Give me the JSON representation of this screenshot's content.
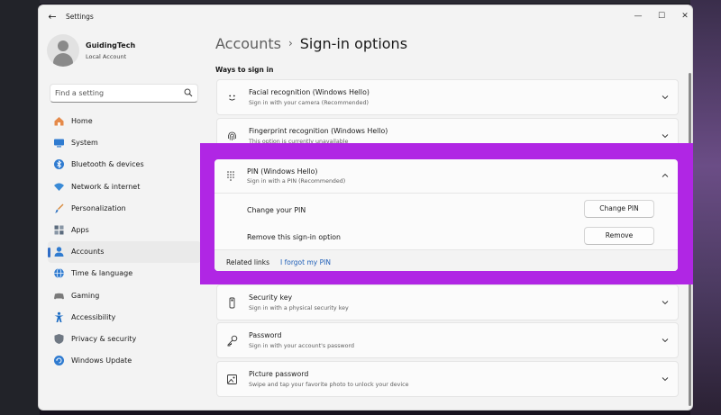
{
  "window": {
    "title": "Settings",
    "back_glyph": "←",
    "minimize_glyph": "—",
    "maximize_glyph": "☐",
    "close_glyph": "✕"
  },
  "profile": {
    "name": "GuidingTech",
    "account_type": "Local Account"
  },
  "search": {
    "placeholder": "Find a setting"
  },
  "sidebar": {
    "items": [
      {
        "label": "Home",
        "icon": "home-icon",
        "color": "#e07a3d"
      },
      {
        "label": "System",
        "icon": "system-icon",
        "color": "#2f7bd0"
      },
      {
        "label": "Bluetooth & devices",
        "icon": "bluetooth-icon",
        "color": "#2f7bd0"
      },
      {
        "label": "Network & internet",
        "icon": "network-icon",
        "color": "#3a8ad6"
      },
      {
        "label": "Personalization",
        "icon": "brush-icon",
        "color": "#d98a3c"
      },
      {
        "label": "Apps",
        "icon": "apps-icon",
        "color": "#5b6b7d"
      },
      {
        "label": "Accounts",
        "icon": "accounts-icon",
        "color": "#2f7bd0",
        "active": true
      },
      {
        "label": "Time & language",
        "icon": "globe-icon",
        "color": "#2f7bd0"
      },
      {
        "label": "Gaming",
        "icon": "gaming-icon",
        "color": "#7a7a7a"
      },
      {
        "label": "Accessibility",
        "icon": "accessibility-icon",
        "color": "#1f6ec4"
      },
      {
        "label": "Privacy & security",
        "icon": "shield-icon",
        "color": "#6f7883"
      },
      {
        "label": "Windows Update",
        "icon": "update-icon",
        "color": "#2f7bd0"
      }
    ]
  },
  "breadcrumb": {
    "parent": "Accounts",
    "separator": "›",
    "current": "Sign-in options"
  },
  "section": {
    "title": "Ways to sign in"
  },
  "sign_in_options": [
    {
      "title": "Facial recognition (Windows Hello)",
      "subtitle": "Sign in with your camera (Recommended)",
      "icon": "face-icon"
    },
    {
      "title": "Fingerprint recognition (Windows Hello)",
      "subtitle": "This option is currently unavailable",
      "icon": "fingerprint-icon"
    },
    {
      "title": "Security key",
      "subtitle": "Sign in with a physical security key",
      "icon": "security-key-icon"
    },
    {
      "title": "Password",
      "subtitle": "Sign in with your account's password",
      "icon": "key-icon"
    },
    {
      "title": "Picture password",
      "subtitle": "Swipe and tap your favorite photo to unlock your device",
      "icon": "picture-icon"
    }
  ],
  "pin": {
    "title": "PIN (Windows Hello)",
    "subtitle": "Sign in with a PIN (Recommended)",
    "icon": "pin-keypad-icon",
    "change_label": "Change your PIN",
    "change_button": "Change PIN",
    "remove_label": "Remove this sign-in option",
    "remove_button": "Remove",
    "related_label": "Related links",
    "forgot_link": "I forgot my PIN"
  },
  "colors": {
    "accent": "#2f6cc6",
    "highlight": "#b026e4",
    "link": "#1f5fb8"
  }
}
